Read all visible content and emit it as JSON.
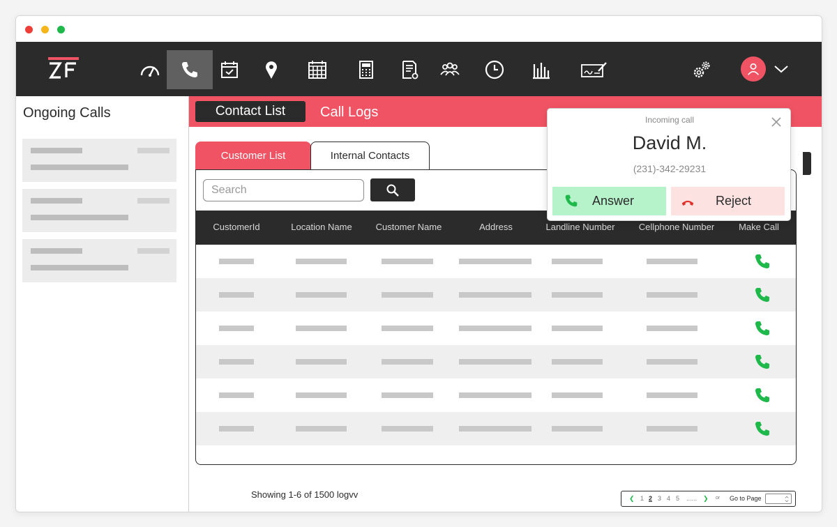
{
  "app": {
    "logo_text": "ZF"
  },
  "nav": {
    "items": [
      {
        "name": "dashboard-gauge-icon"
      },
      {
        "name": "phone-icon",
        "active": true
      },
      {
        "name": "calendar-check-icon"
      },
      {
        "name": "location-pin-icon"
      },
      {
        "name": "calendar-grid-icon"
      },
      {
        "name": "calculator-icon"
      },
      {
        "name": "document-settings-icon"
      },
      {
        "name": "team-icon"
      },
      {
        "name": "clock-icon"
      },
      {
        "name": "bar-chart-icon"
      },
      {
        "name": "signature-icon"
      }
    ],
    "right": [
      "settings-gears-icon",
      "user-avatar-icon",
      "chevron-down-icon"
    ]
  },
  "sidebar": {
    "title": "Ongoing Calls"
  },
  "main": {
    "tabs": {
      "contact_list": "Contact List",
      "call_logs": "Call Logs"
    },
    "subtabs": {
      "customer_list": "Customer List",
      "internal_contacts": "Internal Contacts"
    },
    "search": {
      "placeholder": "Search"
    },
    "table": {
      "columns": [
        "CustomerId",
        "Location Name",
        "Customer Name",
        "Address",
        "Landline Number",
        "Cellphone Number",
        "Make Call"
      ]
    },
    "showing": "Showing 1-6 of 1500 logvv",
    "pager": {
      "pages": [
        "1",
        "2",
        "3",
        "4",
        "5"
      ],
      "current": "2",
      "ellipsis": "......",
      "or": "or",
      "goto": "Go to Page"
    }
  },
  "incoming": {
    "subtitle": "Incoming call",
    "name": "David M.",
    "phone": "(231)-342-29231",
    "answer": "Answer",
    "reject": "Reject"
  },
  "colors": {
    "accent": "#f05464",
    "dark": "#2b2b2b",
    "answer_bg": "#b6f3cb",
    "reject_bg": "#fde2e2",
    "call_green": "#1fb84a"
  }
}
